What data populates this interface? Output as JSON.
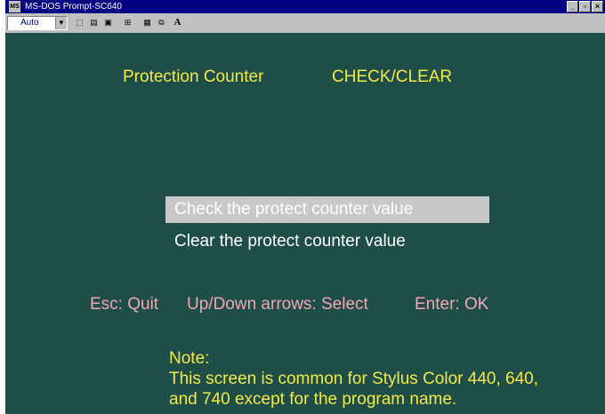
{
  "window": {
    "title": "MS-DOS Prompt-SC640",
    "icon_text": "MS"
  },
  "toolbar": {
    "font_value": "Auto",
    "bold_label": "A"
  },
  "screen": {
    "heading_left": "Protection Counter",
    "heading_right": "CHECK/CLEAR",
    "menu": [
      {
        "label": "Check the protect counter value",
        "selected": true
      },
      {
        "label": "Clear the protect counter value",
        "selected": false
      }
    ],
    "help": {
      "esc": "Esc: Quit",
      "arrows": "Up/Down arrows: Select",
      "enter": "Enter: OK"
    },
    "note": {
      "title": "Note:",
      "line1": "This screen is common for Stylus Color 440, 640,",
      "line2": "and 740 except for the program name."
    }
  },
  "colors": {
    "background": "#1f4d47",
    "heading": "#f3ea46",
    "help": "#f2a7b4",
    "highlight": "#c8c8c8"
  }
}
